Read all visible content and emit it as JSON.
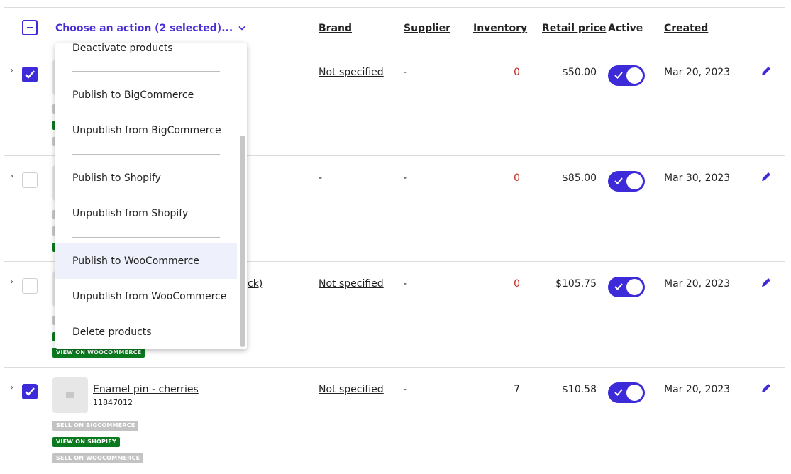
{
  "header": {
    "action_label": "Choose an action (2 selected)...",
    "columns": {
      "brand": "Brand",
      "supplier": "Supplier",
      "inventory": "Inventory",
      "retail_price": "Retail price",
      "active": "Active",
      "created": "Created"
    }
  },
  "dropdown": {
    "items": [
      "Deactivate products",
      "Publish to BigCommerce",
      "Unpublish from BigCommerce",
      "Publish to Shopify",
      "Unpublish from Shopify",
      "Publish to WooCommerce",
      "Unpublish from WooCommerce",
      "Delete products"
    ],
    "highlighted": "Publish to WooCommerce"
  },
  "rows": [
    {
      "selected": true,
      "name": "",
      "name_fragment": "",
      "brand": "Not specified",
      "supplier": "-",
      "inventory": "0",
      "retail_price": "$50.00",
      "active": true,
      "created": "Mar 20, 2023"
    },
    {
      "selected": false,
      "name_fragment": "",
      "brand": "-",
      "supplier": "-",
      "inventory": "0",
      "retail_price": "$85.00",
      "active": true,
      "created": "Mar 30, 2023"
    },
    {
      "selected": false,
      "name_fragment": "ck)",
      "brand": "Not specified",
      "supplier": "-",
      "inventory": "0",
      "retail_price": "$105.75",
      "active": true,
      "created": "Mar 20, 2023",
      "badge": "VIEW ON WOOCOMMERCE"
    },
    {
      "selected": true,
      "name": "Enamel pin - cherries",
      "sku": "11847012",
      "brand": "Not specified",
      "supplier": "-",
      "inventory": "7",
      "retail_price": "$10.58",
      "active": true,
      "created": "Mar 20, 2023",
      "badges": [
        "SELL ON BIGCOMMERCE",
        "VIEW ON SHOPIFY",
        "SELL ON WOOCOMMERCE"
      ]
    }
  ],
  "colors": {
    "accent": "#3d2ad8",
    "link": "#4a2fd6",
    "inventory_zero": "#c0281e",
    "badge_green": "#0b7a1e",
    "badge_gray": "#c3c3c3",
    "dropdown_highlight": "#eef0fc"
  },
  "icons": {
    "expand": "chevron-right-icon",
    "edit": "pencil-icon",
    "dropdown": "chevron-down-icon"
  }
}
